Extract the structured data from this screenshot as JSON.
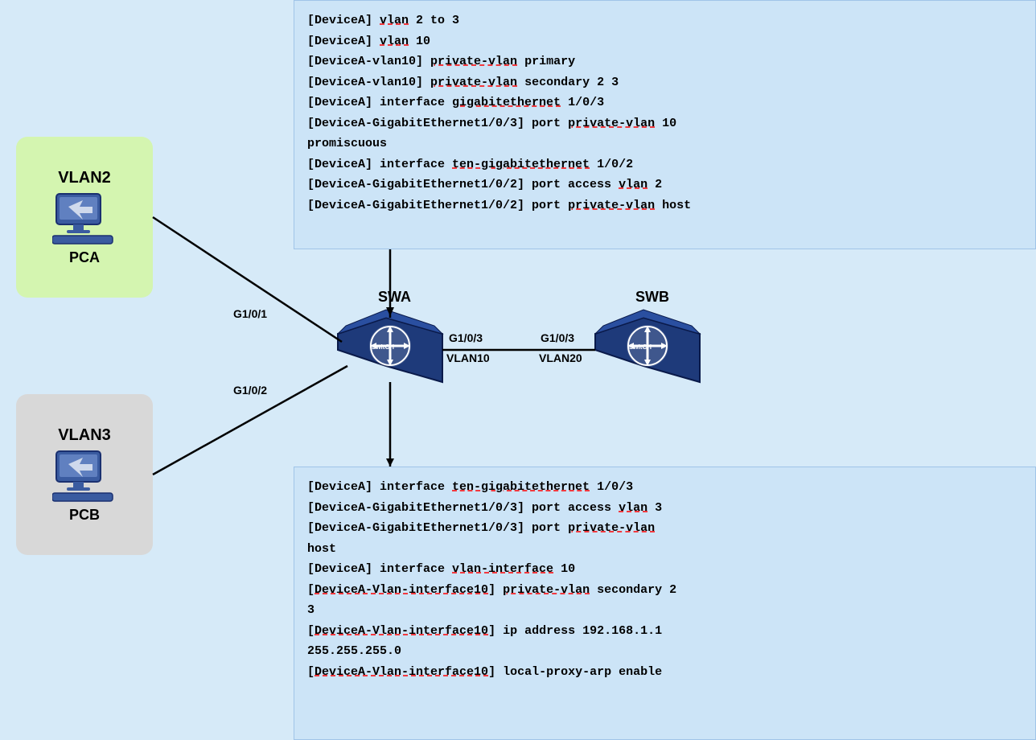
{
  "topConfig": {
    "lines": [
      {
        "text": "[DeviceA] ",
        "rest": "vlan",
        "after": " 2 to 3",
        "underline": "vlan"
      },
      {
        "text": "[DeviceA] ",
        "rest": "vlan",
        "after": " 10",
        "underline": "vlan"
      },
      {
        "text": "[DeviceA-vlan10] ",
        "rest": "private-vlan",
        "after": " primary",
        "underline": "private-vlan"
      },
      {
        "text": "[DeviceA-vlan10] ",
        "rest": "private-vlan",
        "after": " secondary 2 3",
        "underline": "private-vlan"
      },
      {
        "text": "[DeviceA] interface ",
        "rest": "gigabitethernet",
        "after": " 1/0/3",
        "underline": "gigabitethernet"
      },
      {
        "text": "[DeviceA-GigabitEthernet1/0/3] port ",
        "rest": "private-vlan",
        "after": " 10 promiscuous",
        "underline": "private-vlan"
      },
      {
        "text": "[DeviceA] interface ",
        "rest": "ten-gigabitethernet",
        "after": " 1/0/2",
        "underline": "ten-gigabitethernet"
      },
      {
        "text": "[DeviceA-GigabitEthernet1/0/2] port access vlan 2",
        "rest": "",
        "after": "",
        "underline": ""
      },
      {
        "text": "[DeviceA-GigabitEthernet1/0/2] port ",
        "rest": "private-vlan",
        "after": " host",
        "underline": "private-vlan"
      }
    ]
  },
  "bottomConfig": {
    "lines": [
      {
        "text": "[DeviceA] interface ",
        "rest": "ten-gigabitethernet",
        "after": " 1/0/3",
        "underline": "ten-gigabitethernet"
      },
      {
        "text": "[DeviceA-GigabitEthernet1/0/3] port access vlan 3",
        "rest": "",
        "after": "",
        "underline": ""
      },
      {
        "text": "[DeviceA-GigabitEthernet1/0/3] port ",
        "rest": "private-vlan",
        "after": " host",
        "underline": "private-vlan"
      },
      {
        "text": "host",
        "rest": "",
        "after": "",
        "underline": ""
      },
      {
        "text": "[DeviceA] interface ",
        "rest": "vlan-interface",
        "after": " 10",
        "underline": "vlan-interface"
      },
      {
        "text": "[DeviceA-Vlan-interface10] ",
        "rest": "private-vlan",
        "after": " secondary 2",
        "underline": "private-vlan"
      },
      {
        "text": "3",
        "rest": "",
        "after": "",
        "underline": ""
      },
      {
        "text": "[DeviceA-Vlan-interface10] ip address 192.168.1.1",
        "rest": "",
        "after": "",
        "underline": ""
      },
      {
        "text": "255.255.255.0",
        "rest": "",
        "after": "",
        "underline": ""
      },
      {
        "text": "[DeviceA-Vlan-interface10] local-proxy-arp enable",
        "rest": "",
        "after": "",
        "underline": ""
      }
    ]
  },
  "vlan2": {
    "label": "VLAN2",
    "pc": "PCA"
  },
  "vlan3": {
    "label": "VLAN3",
    "pc": "PCB"
  },
  "swa": {
    "label": "SWA"
  },
  "swb": {
    "label": "SWB"
  },
  "ports": {
    "g101": "G1/0/1",
    "g102": "G1/0/2",
    "g103swa": "G1/0/3",
    "g103swb": "G1/0/3",
    "vlan10": "VLAN10",
    "vlan20": "VLAN20"
  },
  "switchText": "SwitCH"
}
